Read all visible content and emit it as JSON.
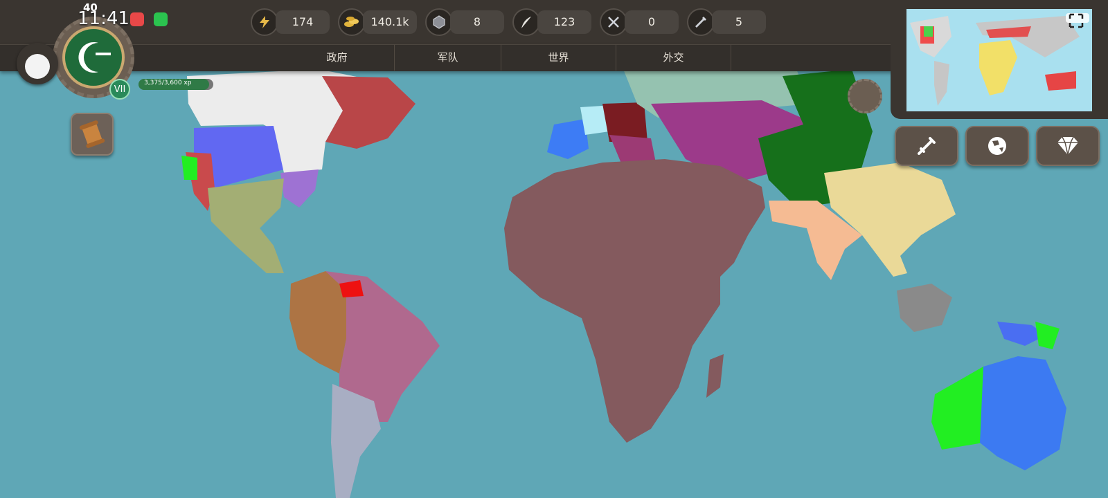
{
  "status_bar": {
    "time": "11:41",
    "badge_count": "40"
  },
  "resources": [
    {
      "icon": "lightning-icon",
      "value": "174"
    },
    {
      "icon": "gold-coins-icon",
      "value": "140.1k"
    },
    {
      "icon": "stone-icon",
      "value": "8"
    },
    {
      "icon": "feather-icon",
      "value": "123"
    },
    {
      "icon": "crossed-swords-icon",
      "value": "0"
    },
    {
      "icon": "sword-icon",
      "value": "5"
    }
  ],
  "nav_tabs": [
    {
      "label": "政府"
    },
    {
      "label": "军队"
    },
    {
      "label": "世界"
    },
    {
      "label": "外交"
    }
  ],
  "player": {
    "era": "VII",
    "xp_text": "3,375/3,600 xp",
    "xp_fraction": 0.94
  },
  "side_buttons": [
    {
      "icon": "sword-icon"
    },
    {
      "icon": "globe-icon"
    },
    {
      "icon": "diamond-icon"
    }
  ],
  "colors": {
    "ocean": "#5fa7b6",
    "bar": "#3a3530",
    "africa": "#845a5e",
    "green_flag": "#1f6b3a"
  }
}
